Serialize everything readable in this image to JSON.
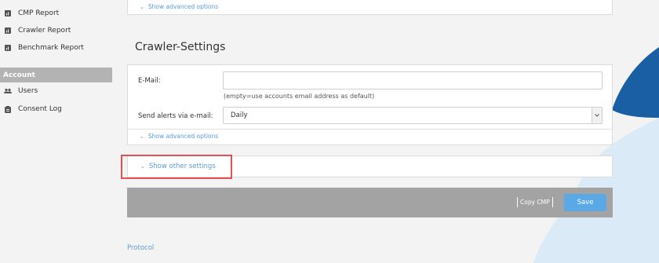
{
  "sidebar": {
    "items_top": [
      {
        "label": "CMP Report",
        "icon": "report-icon"
      },
      {
        "label": "Crawler Report",
        "icon": "report-icon"
      },
      {
        "label": "Benchmark Report",
        "icon": "report-icon"
      }
    ],
    "section_label": "Account",
    "items_account": [
      {
        "label": "Users",
        "icon": "users-icon"
      },
      {
        "label": "Consent Log",
        "icon": "log-icon"
      }
    ]
  },
  "top_panel": {
    "advanced_link": "Show advanced options"
  },
  "crawler_settings": {
    "title": "Crawler-Settings",
    "email_label": "E-Mail:",
    "email_value": "",
    "email_hint": "(empty=use accounts email address as default)",
    "alerts_label": "Send alerts via e-mail:",
    "alerts_value": "Daily",
    "advanced_link": "Show advanced options"
  },
  "other_settings": {
    "link_label": "Show other settings"
  },
  "actions": {
    "copy_label": "Copy CMP",
    "save_label": "Save"
  },
  "footer": {
    "protocol_label": "Protocol"
  },
  "colors": {
    "accent": "#5b9bd5",
    "save_button": "#5aa9e6",
    "action_bar": "#a3a3a3",
    "highlight": "#e15154",
    "deco_dark": "#1a5fa3",
    "deco_light": "#cfe2f5"
  }
}
